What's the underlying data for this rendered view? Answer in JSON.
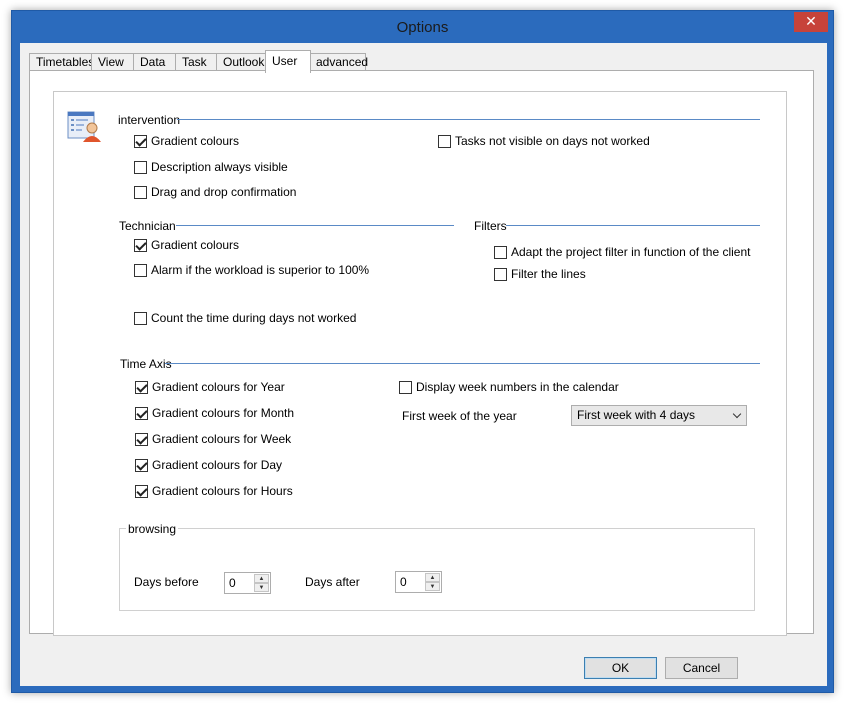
{
  "window": {
    "title": "Options",
    "close_label": "✕"
  },
  "tabs": [
    {
      "label": "Timetables"
    },
    {
      "label": "View"
    },
    {
      "label": "Data"
    },
    {
      "label": "Task"
    },
    {
      "label": "Outlook"
    },
    {
      "label": "User"
    },
    {
      "label": "advanced"
    }
  ],
  "active_tab": "User",
  "intervention": {
    "label": "intervention",
    "gradient_colours": {
      "label": "Gradient colours",
      "checked": true
    },
    "description_visible": {
      "label": "Description always visible",
      "checked": false
    },
    "drag_drop": {
      "label": "Drag and drop confirmation",
      "checked": false
    },
    "tasks_not_visible": {
      "label": "Tasks not visible on days not worked",
      "checked": false
    }
  },
  "technician": {
    "label": "Technician",
    "gradient_colours": {
      "label": "Gradient colours",
      "checked": true
    },
    "alarm_workload": {
      "label": "Alarm if the workload is superior to 100%",
      "checked": false
    },
    "count_time": {
      "label": "Count the time during days not worked",
      "checked": false
    }
  },
  "filters": {
    "label": "Filters",
    "adapt_project": {
      "label": "Adapt the project filter in function of the client",
      "checked": false
    },
    "filter_lines": {
      "label": "Filter the lines",
      "checked": false
    }
  },
  "time_axis": {
    "label": "Time Axis",
    "year": {
      "label": "Gradient colours for Year",
      "checked": true
    },
    "month": {
      "label": "Gradient colours for Month",
      "checked": true
    },
    "week": {
      "label": "Gradient colours for Week",
      "checked": true
    },
    "day": {
      "label": "Gradient colours for Day",
      "checked": true
    },
    "hours": {
      "label": "Gradient colours for Hours",
      "checked": true
    },
    "week_numbers": {
      "label": "Display week numbers in the calendar",
      "checked": false
    },
    "first_week_label": "First week of the year",
    "first_week_value": "First week with 4 days"
  },
  "browsing": {
    "label": "browsing",
    "days_before_label": "Days before",
    "days_before_value": "0",
    "days_after_label": "Days after",
    "days_after_value": "0"
  },
  "buttons": {
    "ok": "OK",
    "cancel": "Cancel"
  },
  "colors": {
    "accent": "#2b6bbd",
    "close": "#c7433a",
    "separator": "#5a8ac6"
  }
}
